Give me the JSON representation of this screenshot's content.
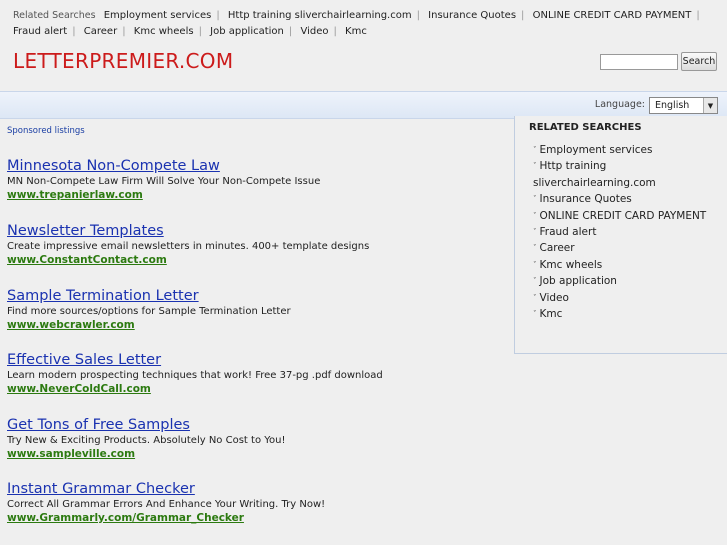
{
  "topbar": {
    "label": "Related Searches",
    "links": [
      "Employment services",
      "Http training sliverchairlearning.com",
      "Insurance Quotes",
      "ONLINE CREDIT CARD PAYMENT",
      "Fraud alert",
      "Career",
      "Kmc wheels",
      "Job application",
      "Video",
      "Kmc"
    ],
    "separator": "|"
  },
  "site": {
    "domain": "LETTERPREMIER.COM"
  },
  "search": {
    "value": "",
    "button_label": "Search"
  },
  "language": {
    "label": "Language:",
    "selected": "English"
  },
  "sponsored": {
    "label": "Sponsored listings"
  },
  "ads": [
    {
      "title": "Minnesota Non-Compete Law",
      "desc": "MN Non-Compete Law Firm Will Solve Your Non-Compete Issue",
      "url": "www.trepanierlaw.com"
    },
    {
      "title": "Newsletter Templates",
      "desc": "Create impressive email newsletters in minutes. 400+ template designs",
      "url": "www.ConstantContact.com"
    },
    {
      "title": "Sample Termination Letter",
      "desc": "Find more sources/options for Sample Termination Letter",
      "url": "www.webcrawler.com"
    },
    {
      "title": "Effective Sales Letter",
      "desc": "Learn modern prospecting techniques that work! Free 37-pg .pdf download",
      "url": "www.NeverColdCall.com"
    },
    {
      "title": "Get Tons of Free Samples",
      "desc": "Try New & Exciting Products. Absolutely No Cost to You!",
      "url": "www.sampleville.com"
    },
    {
      "title": "Instant Grammar Checker",
      "desc": "Correct All Grammar Errors And Enhance Your Writing. Try Now!",
      "url": "www.Grammarly.com/Grammar_Checker"
    }
  ],
  "related": {
    "heading": "RELATED SEARCHES",
    "bullet": "ˇ",
    "items": [
      "Employment services",
      "Http training sliverchairlearning.com",
      "Insurance Quotes",
      "ONLINE CREDIT CARD PAYMENT",
      "Fraud alert",
      "Career",
      "Kmc wheels",
      "Job application",
      "Video",
      "Kmc"
    ]
  },
  "colors": {
    "domain": "#cc1b1b",
    "ad_title": "#1a32b0",
    "ad_url": "#2c7a10",
    "background": "#efefef"
  }
}
